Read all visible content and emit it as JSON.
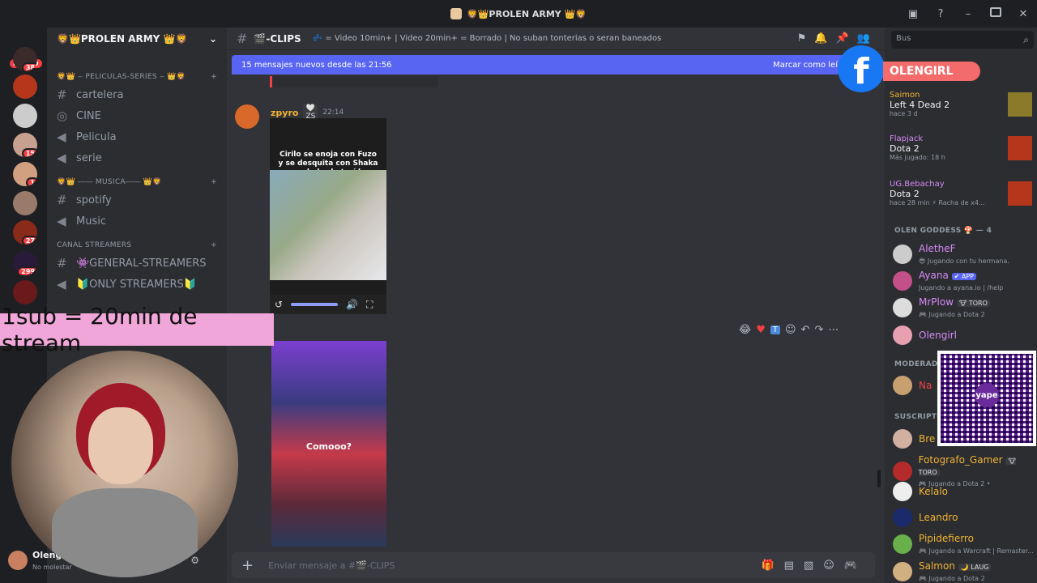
{
  "window": {
    "title": "🦁👑PROLEN ARMY 👑🦁"
  },
  "rail": {
    "new_badge": "NUEVO",
    "badges": [
      "38",
      "15",
      "1",
      "27",
      "299"
    ]
  },
  "guild": {
    "name": "🦁👑PROLEN ARMY 👑🦁"
  },
  "categories": [
    {
      "label": "🦁👑 ‒ PELICULAS-SERIES ‒ 👑🦁",
      "channels": [
        "cartelera",
        "CINE",
        "Pelicula",
        "serie"
      ]
    },
    {
      "label": "🦁👑 ―― MUSICA―― 👑🦁",
      "channels": [
        "spotify",
        "Music"
      ]
    },
    {
      "label": "CANAL STREAMERS",
      "channels": [
        "👾GENERAL-STREAMERS",
        "🔰ONLY STREAMERS🔰"
      ]
    }
  ],
  "channel_header": {
    "name": "🎬-CLIPS",
    "topic": "💤 = Video 10min+ | Video 20min+ = Borrado | No suban tonterias o seran baneados"
  },
  "new_messages": {
    "text": "15 mensajes nuevos desde las 21:56",
    "action": "Marcar como leí"
  },
  "message": {
    "author": "zpyro",
    "tag": "🤍 ZS",
    "time": "22:14",
    "clip1_caption": "Cirilo se enoja con Fuzo y se desquita con Shaka por haberlo traído",
    "clip2_caption": "Comooo?"
  },
  "composer": {
    "placeholder": "Enviar mensaje a #🎬-CLIPS"
  },
  "user": {
    "name": "Olengirl",
    "status": "No molestar"
  },
  "search": {
    "placeholder": "Bus"
  },
  "activities": [
    {
      "name": "Saimon",
      "game": "Left 4 Dead 2",
      "time": "hace 3 d"
    },
    {
      "name": "Flapjack",
      "game": "Dota 2",
      "time": "Más jugado: 18 h"
    },
    {
      "name": "UG.Bebachay",
      "game": "Dota 2",
      "time": "hace 28 min  ⚡ Racha de x4..."
    }
  ],
  "groups": {
    "goddess": "OLEN GODDESS 🍄 — 4",
    "moderators": "MODERAD",
    "subscribers": "SUSCRIPTO"
  },
  "members": [
    {
      "name": "AletheF",
      "status": "😎 Jugando con tu hermana.",
      "color": "#d78bf7"
    },
    {
      "name": "Ayana",
      "badge": "✔ APP",
      "status": "Jugando a ayana.io | /help",
      "color": "#d78bf7"
    },
    {
      "name": "MrPlow",
      "badge": "🐮 TORO",
      "status": "🎮 Jugando a Dota 2",
      "color": "#d78bf7"
    },
    {
      "name": "Olengirl",
      "color": "#d78bf7"
    },
    {
      "name": "Na",
      "color": "#f23f43"
    },
    {
      "name": "Bre",
      "color": "#f0b232"
    },
    {
      "name": "Fotografo_Gamer",
      "badge": "🐮 TORO",
      "status": "🎮 Jugando a Dota 2 •",
      "color": "#f0b232"
    },
    {
      "name": "Kelalo",
      "color": "#f0b232"
    },
    {
      "name": "Leandro",
      "color": "#f0b232"
    },
    {
      "name": "Pipidefierro",
      "status": "🎮 Jugando a Warcraft | Remaster...",
      "color": "#f0b232"
    },
    {
      "name": "Salmon",
      "badge": "🌙 LAUG",
      "status": "🎮 Jugando a Dota 2",
      "color": "#f0b232"
    }
  ],
  "overlays": {
    "sub_banner": "1sub = 20min de stream",
    "facebook_name": "OLENGIRL",
    "qr_label": "yape"
  },
  "colors": {
    "accent": "#5865f2",
    "author": "#f0b232",
    "banner": "#f0a6d8",
    "facebook": "#1877f2"
  }
}
